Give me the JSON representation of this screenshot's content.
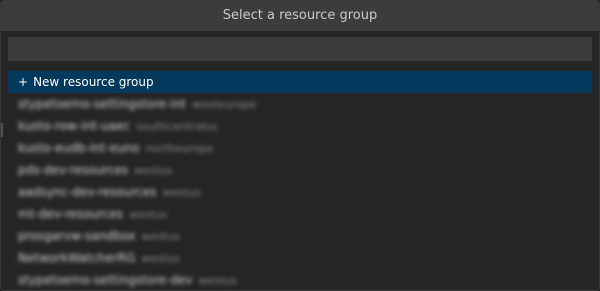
{
  "picker": {
    "title": "Select a resource group",
    "filter_value": "",
    "filter_placeholder": ""
  },
  "new_item": {
    "icon": "+",
    "label": "New resource group"
  },
  "items": [
    {
      "name": "stypetoemo-settingstore-int",
      "region": "westeurope"
    },
    {
      "name": "kusto-row-int-uaec",
      "region": "southcentralus"
    },
    {
      "name": "kusto-eudb-int-euno",
      "region": "northeurope"
    },
    {
      "name": "pds-dev-resources",
      "region": "westus"
    },
    {
      "name": "aadsync-dev-resources",
      "region": "westus"
    },
    {
      "name": "mt-dev-resources",
      "region": "westus"
    },
    {
      "name": "prosgarvw-sandbox",
      "region": "westus"
    },
    {
      "name": "NetworkWatcherRG",
      "region": "westus"
    },
    {
      "name": "stypetoemo-settingstore-dev",
      "region": "westus"
    }
  ],
  "colors": {
    "background": "#252526",
    "selected_row": "#04395e",
    "title_bar": "#3c3c3c"
  }
}
